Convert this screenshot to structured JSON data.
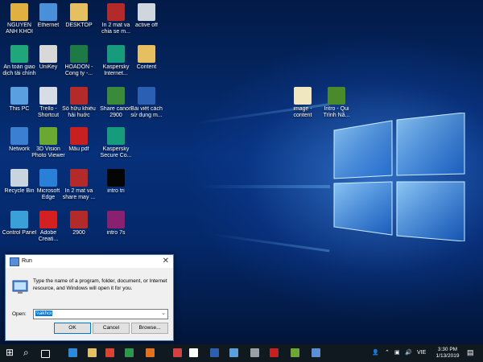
{
  "desktop": {
    "icons": [
      {
        "label": "NGUYEN\nANH KHOI",
        "icon": "user-folder-icon",
        "color": "#e0b040"
      },
      {
        "label": "Ethernet",
        "icon": "network-icon",
        "color": "#4a90d9"
      },
      {
        "label": "DESKTOP",
        "icon": "folder-icon",
        "color": "#e6c060"
      },
      {
        "label": "In 2 mat va\nchia se m...",
        "icon": "video-icon",
        "color": "#b32a2a"
      },
      {
        "label": "active off",
        "icon": "program-icon",
        "color": "#cfd6de"
      },
      {
        "label": "An toàn giao\ndịch tài chính",
        "icon": "shield-app-icon",
        "color": "#1fa67a"
      },
      {
        "label": "UniKey",
        "icon": "unikey-icon",
        "color": "#d8d8d8"
      },
      {
        "label": "HOADON -\nCong ty -...",
        "icon": "excel-icon",
        "color": "#1d7a45"
      },
      {
        "label": "Kaspersky\nInternet...",
        "icon": "kaspersky-icon",
        "color": "#169c7c"
      },
      {
        "label": "Content",
        "icon": "folder-icon",
        "color": "#e6c060"
      },
      {
        "label": "This PC",
        "icon": "computer-icon",
        "color": "#5aa0e0"
      },
      {
        "label": "Trello -\nShortcut",
        "icon": "trello-icon",
        "color": "#d7dde4"
      },
      {
        "label": "Sổ hữu khiếu\nhải huớc",
        "icon": "video-icon",
        "color": "#b32a2a"
      },
      {
        "label": "Share canon\n2900",
        "icon": "video-icon",
        "color": "#3a8a3a"
      },
      {
        "label": "Bài viết cách\nsử dụng m...",
        "icon": "word-icon",
        "color": "#2b5fb4"
      },
      {
        "label": "Network",
        "icon": "network-globe-icon",
        "color": "#3a7fd0"
      },
      {
        "label": "3D Vision\nPhoto Viewer",
        "icon": "nvidia-icon",
        "color": "#6aa832"
      },
      {
        "label": "Mẫu pdf",
        "icon": "pdf-icon",
        "color": "#c82020"
      },
      {
        "label": "Kaspersky\nSecure Co...",
        "icon": "kaspersky-secure-icon",
        "color": "#169c7c"
      },
      {
        "label": "Recycle Bin",
        "icon": "recycle-bin-icon",
        "color": "#c8d4e0"
      },
      {
        "label": "Microsoft\nEdge",
        "icon": "edge-icon",
        "color": "#2a7fd6"
      },
      {
        "label": "In 2 mat va\nshare may ...",
        "icon": "video-icon",
        "color": "#b32a2a"
      },
      {
        "label": "intro tri",
        "icon": "black-thumbnail-icon",
        "color": "#050505"
      },
      {
        "label": "Control Panel",
        "icon": "control-panel-icon",
        "color": "#3aa0d8"
      },
      {
        "label": "Adobe\nCreati...",
        "icon": "adobe-cc-icon",
        "color": "#d42020"
      },
      {
        "label": "2900",
        "icon": "video-icon",
        "color": "#b32a2a"
      },
      {
        "label": "intro 7s",
        "icon": "video-icon",
        "color": "#8a2070"
      },
      {
        "label": "image -\ncontent",
        "icon": "file-icon",
        "color": "#f0e6c0"
      },
      {
        "label": "Intro - Qui\nTrình Nă...",
        "icon": "video-icon",
        "color": "#4a8a2a"
      }
    ]
  },
  "run_dialog": {
    "title": "Run",
    "description": "Type the name of a program, folder, document, or Internet resource, and Windows will open it for you.",
    "open_label": "Open:",
    "open_value": "\\\\akhoi",
    "ok_label": "OK",
    "cancel_label": "Cancel",
    "browse_label": "Browse..."
  },
  "taskbar": {
    "apps": [
      {
        "name": "start-button",
        "icon": "windows-icon",
        "color": "#ffffff"
      },
      {
        "name": "search-button",
        "icon": "search-icon",
        "color": "#ffffff"
      },
      {
        "name": "task-view-button",
        "icon": "task-view-icon",
        "color": "#ffffff"
      },
      {
        "name": "taskbar-edge",
        "icon": "edge-icon",
        "color": "#2a8ae0"
      },
      {
        "name": "taskbar-explorer",
        "icon": "folder-icon",
        "color": "#e6c060"
      },
      {
        "name": "taskbar-chrome",
        "icon": "chrome-icon",
        "color": "#e04030"
      },
      {
        "name": "taskbar-coccoc",
        "icon": "coccoc-icon",
        "color": "#2a9a4a"
      },
      {
        "name": "taskbar-firefox",
        "icon": "firefox-icon",
        "color": "#e8701a"
      },
      {
        "name": "taskbar-mail",
        "icon": "mail-icon",
        "color": "#d64040"
      },
      {
        "name": "taskbar-mail-app",
        "icon": "mail-icon",
        "color": "#ffffff"
      },
      {
        "name": "taskbar-word",
        "icon": "word-icon",
        "color": "#2b5fb4"
      },
      {
        "name": "taskbar-pc",
        "icon": "computer-icon",
        "color": "#5aa0e0"
      },
      {
        "name": "taskbar-app-gray",
        "icon": "program-icon",
        "color": "#9aa0a6"
      },
      {
        "name": "taskbar-pdf",
        "icon": "pdf-icon",
        "color": "#c82020"
      },
      {
        "name": "taskbar-photos",
        "icon": "photo-icon",
        "color": "#6aa832"
      },
      {
        "name": "taskbar-run",
        "icon": "run-icon",
        "color": "#5a8fd8"
      }
    ],
    "language": "VIE",
    "time": "3:30 PM",
    "date": "1/13/2019"
  }
}
